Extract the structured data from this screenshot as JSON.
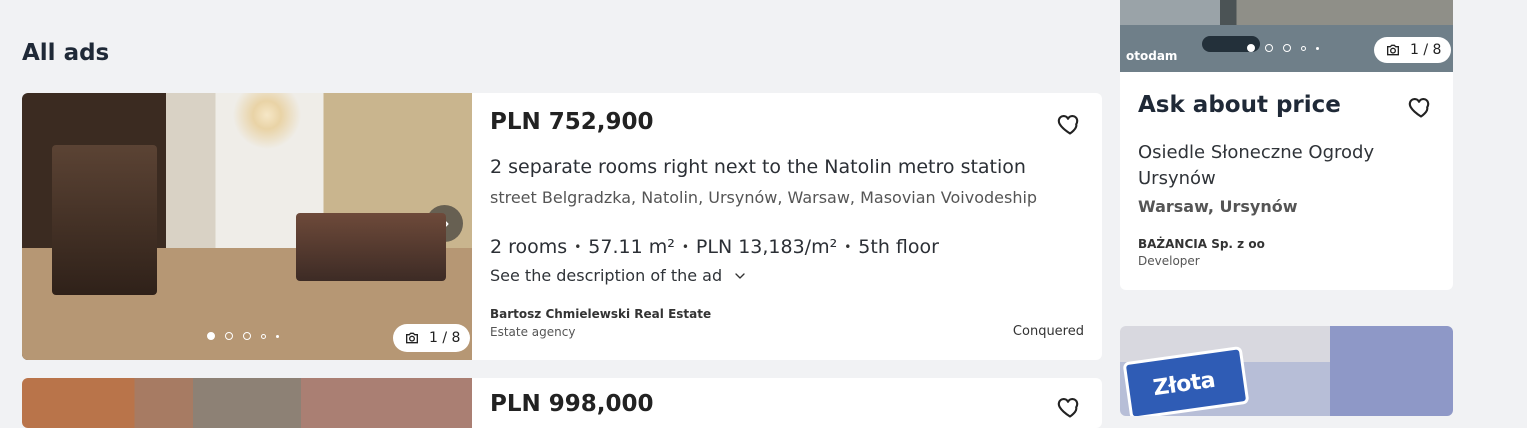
{
  "section": {
    "title": "All ads"
  },
  "listing1": {
    "price": "PLN 752,900",
    "title": "2 separate rooms right next to the Natolin metro station",
    "address": "street Belgradzka, Natolin, Ursynów, Warsaw, Masovian Voivodeship",
    "specs": [
      "2 rooms",
      "57.11 m²",
      "PLN 13,183/m²",
      "5th floor"
    ],
    "spec_separator": "•",
    "description_link": "See the description of the ad",
    "agency": "Bartosz Chmielewski Real Estate",
    "agency_type": "Estate agency",
    "status": "Conquered",
    "photo_counter": "1 / 8",
    "icons": {
      "next": "chevron-right-icon",
      "camera": "camera-icon",
      "favorite": "heart-icon",
      "expand": "chevron-down-icon"
    }
  },
  "listing2": {
    "price": "PLN 998,000"
  },
  "sidebar": {
    "promo_top": {
      "brand": "otodam",
      "photo_counter": "1 / 8"
    },
    "ask_card": {
      "title": "Ask about price",
      "project": "Osiedle Słoneczne Ogrody Ursynów",
      "location": "Warsaw, Ursynów",
      "developer": "BAŻANCIA Sp. z oo",
      "developer_type": "Developer"
    },
    "promo_bottom": {
      "sign_text": "Złota"
    }
  },
  "colors": {
    "page_bg": "#f1f2f4",
    "card_bg": "#ffffff",
    "text_primary": "#1f2937",
    "text_secondary": "#555555"
  }
}
